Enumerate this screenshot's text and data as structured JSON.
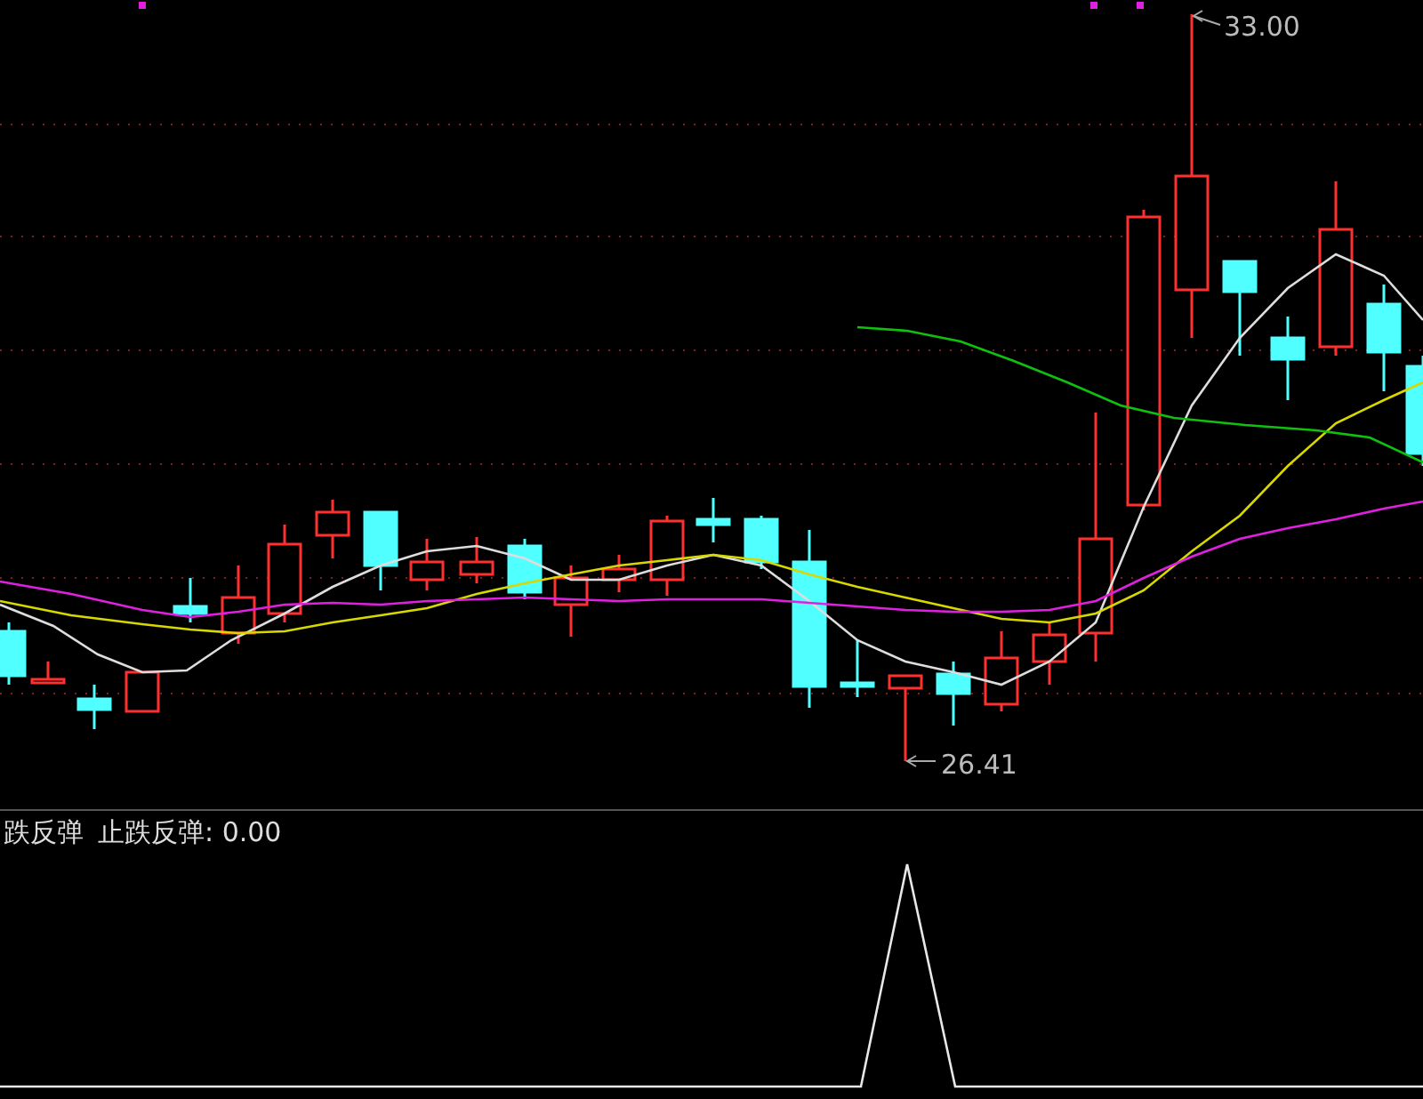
{
  "price_chart": {
    "high_label": "33.00",
    "low_label": "26.41"
  },
  "indicator": {
    "title_cut": "跌反弹",
    "label": "止跌反弹: 0.00"
  }
}
